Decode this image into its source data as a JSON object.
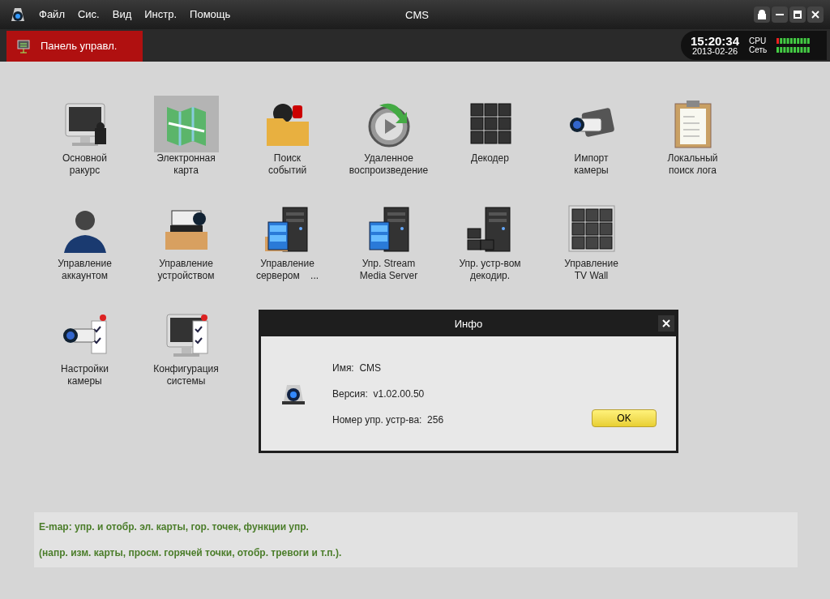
{
  "menu": [
    "Файл",
    "Сис.",
    "Вид",
    "Инстр.",
    "Помощь"
  ],
  "window": {
    "title": "CMS"
  },
  "tab": {
    "label": "Панель управл.",
    "selected": true
  },
  "clock": {
    "time": "15:20:34",
    "date": "2013-02-26"
  },
  "meters": [
    {
      "label": "CPU"
    },
    {
      "label": "Сеть"
    }
  ],
  "module_rows": [
    [
      {
        "lines": [
          "Основной",
          "ракурс"
        ],
        "selected": false
      },
      {
        "lines": [
          "Электронная",
          "карта"
        ],
        "selected": true
      },
      {
        "lines": [
          "Поиск",
          "событий"
        ],
        "selected": false
      },
      {
        "lines": [
          "Удаленное",
          "воспроизведение"
        ],
        "selected": false
      },
      {
        "lines": [
          "Декодер"
        ],
        "selected": false
      },
      {
        "lines": [
          "Импорт",
          "камеры"
        ],
        "selected": false
      },
      {
        "lines": [
          "Локальный",
          "поиск лога"
        ],
        "selected": false
      }
    ],
    [
      {
        "lines": [
          "Управление",
          "аккаунтом"
        ],
        "selected": false
      },
      {
        "lines": [
          "Управление",
          "устройством"
        ],
        "selected": false
      },
      {
        "lines": [
          "Управление",
          "сервером    ..."
        ],
        "selected": false
      },
      {
        "lines": [
          "Упр. Stream",
          "Media Server"
        ],
        "selected": false
      },
      {
        "lines": [
          "Упр. устр-вом",
          "декодир."
        ],
        "selected": false
      },
      {
        "lines": [
          "Управление",
          "TV Wall"
        ],
        "selected": false
      }
    ],
    [
      {
        "lines": [
          "Настройки",
          "камеры"
        ],
        "selected": false
      },
      {
        "lines": [
          "Конфигурация",
          "системы"
        ],
        "selected": false
      }
    ]
  ],
  "dialog": {
    "title": "Инфо",
    "fields": [
      "Имя:  CMS",
      "Версия:  v1.02.00.50",
      "Номер упр. устр-ва:  256"
    ],
    "button": "OK"
  },
  "description": [
    "E-map: упр. и отобр. эл. карты, гор. точек, функции упр.",
    "(напр. изм. карты, просм. горячей точки, отобр. тревоги и т.п.)."
  ]
}
